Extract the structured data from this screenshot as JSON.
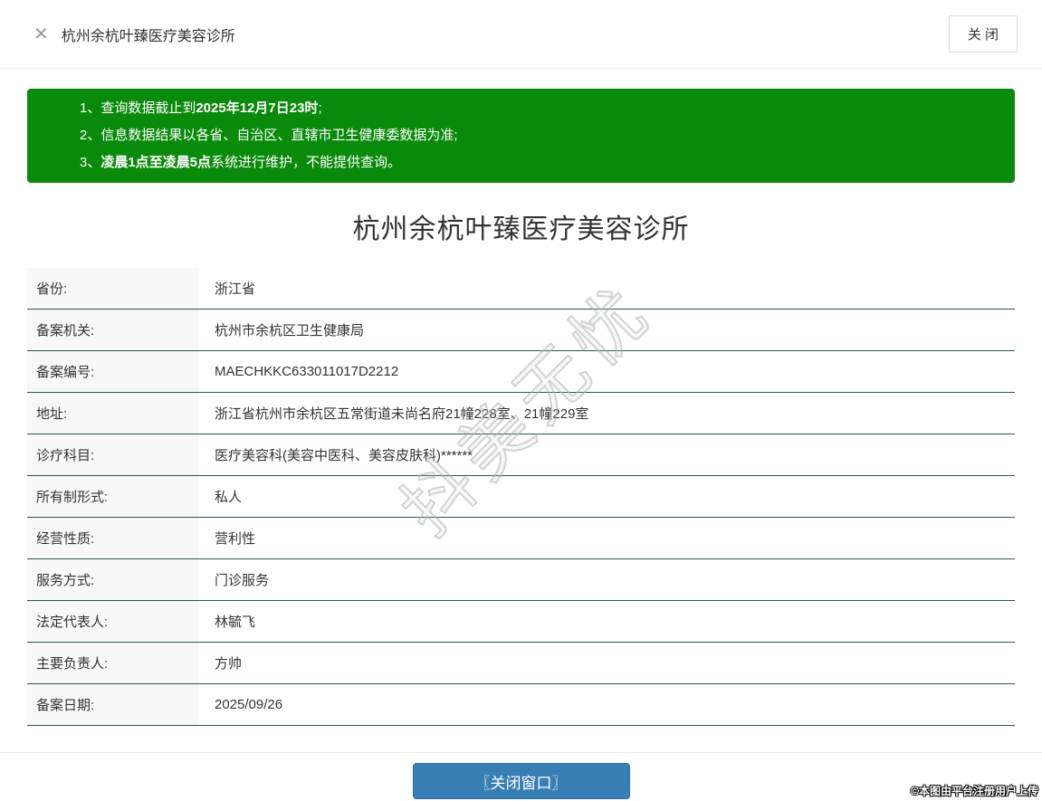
{
  "header": {
    "close_icon": "✕",
    "title": "杭州余杭叶臻医疗美容诊所",
    "close_button_label": "关 闭"
  },
  "notice": {
    "lines": [
      {
        "pre": "1、查询数据截止到",
        "bold": "2025年12月7日23时",
        "post": ";"
      },
      {
        "pre": "2、信息数据结果以各省、自治区、直辖市卫生健康委数据为准;",
        "bold": "",
        "post": ""
      },
      {
        "pre": "3、",
        "bold": "凌晨1点至凌晨5点",
        "post": "系统进行维护，不能提供查询。"
      }
    ]
  },
  "detail": {
    "title": "杭州余杭叶臻医疗美容诊所",
    "rows": [
      {
        "label": "省份:",
        "value": "浙江省"
      },
      {
        "label": "备案机关:",
        "value": "杭州市余杭区卫生健康局"
      },
      {
        "label": "备案编号:",
        "value": "MAECHKKC633011017D2212"
      },
      {
        "label": "地址:",
        "value": "浙江省杭州市余杭区五常街道未尚名府21幢228室、21幢229室"
      },
      {
        "label": "诊疗科目:",
        "value": "医疗美容科(美容中医科、美容皮肤科)******"
      },
      {
        "label": "所有制形式:",
        "value": "私人"
      },
      {
        "label": "经营性质:",
        "value": "营利性"
      },
      {
        "label": "服务方式:",
        "value": "门诊服务"
      },
      {
        "label": "法定代表人:",
        "value": "林毓飞"
      },
      {
        "label": "主要负责人:",
        "value": "方帅"
      },
      {
        "label": "备案日期:",
        "value": "2025/09/26"
      }
    ]
  },
  "footer": {
    "close_window_button": "〖关闭窗口〗"
  },
  "watermark": {
    "text": "抖美无忧"
  },
  "attribution": "©本图由平台注册用户上传",
  "colors": {
    "notice_green": "#0a8a0a",
    "button_blue": "#377eb4",
    "row_divider": "#2b5a47"
  }
}
